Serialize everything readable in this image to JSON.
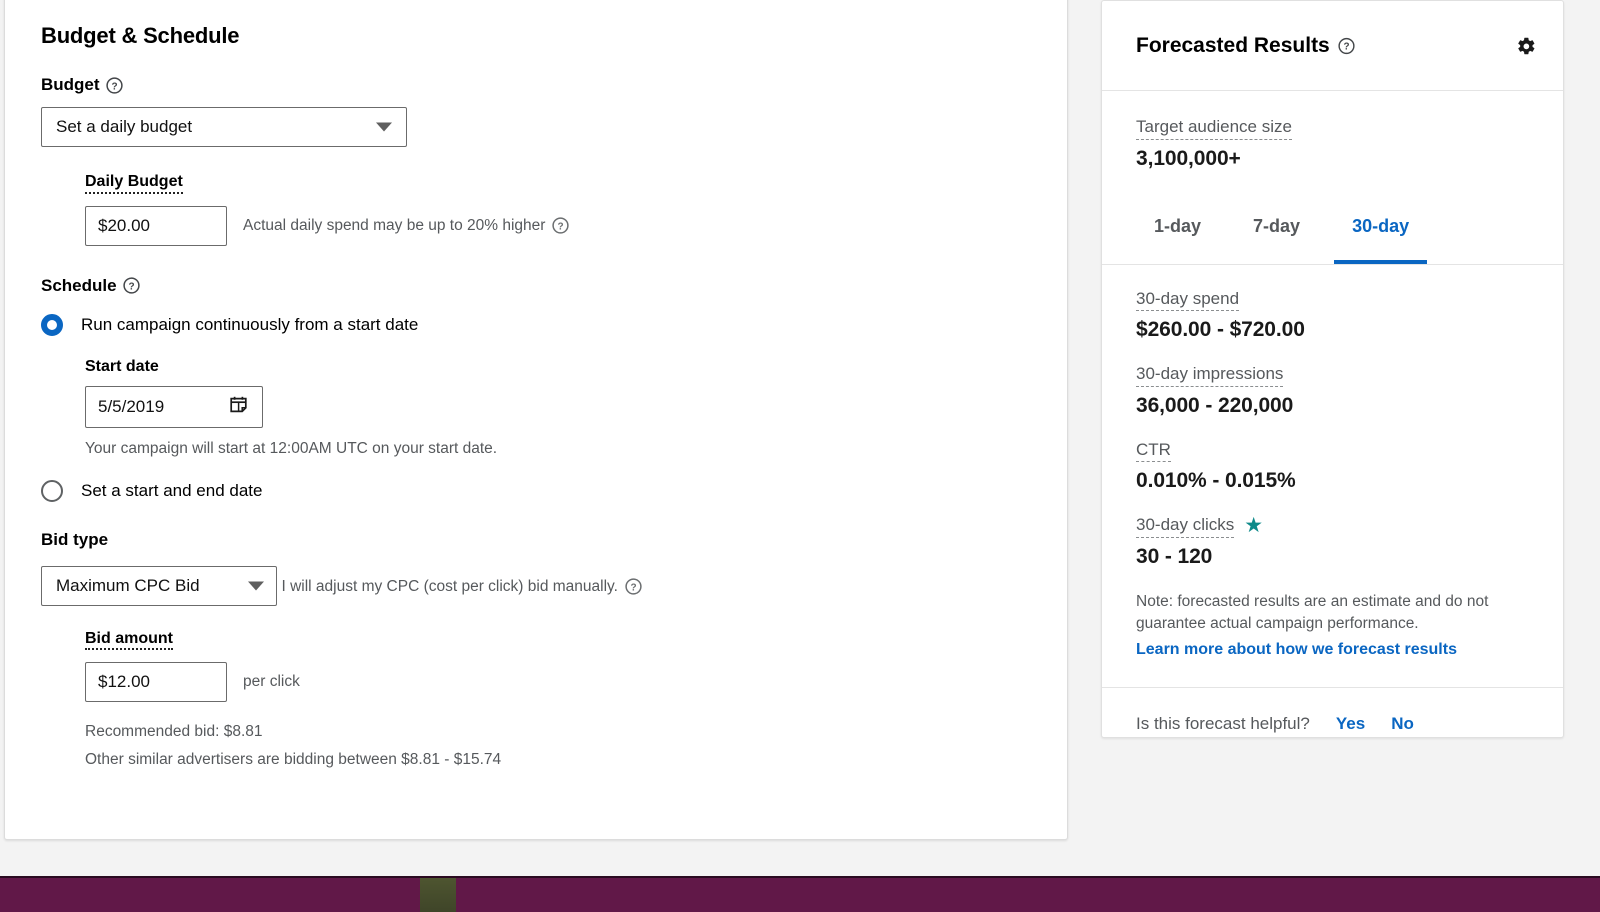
{
  "budget_section": {
    "title": "Budget & Schedule",
    "budget_label": "Budget",
    "budget_help_icon": "help-circle-icon",
    "budget_type_value": "Set a daily budget",
    "budget_type_caret_icon": "chevron-down-icon",
    "daily_budget_label": "Daily Budget",
    "daily_budget_value": "$20.00",
    "daily_budget_hint": "Actual daily spend may be up to 20% higher",
    "daily_budget_hint_icon": "help-circle-icon"
  },
  "schedule_section": {
    "label": "Schedule",
    "help_icon": "help-circle-icon",
    "option_continuous": "Run campaign continuously from a start date",
    "option_start_end": "Set a start and end date",
    "start_date_label": "Start date",
    "start_date_value": "5/5/2019",
    "calendar_icon": "calendar-icon",
    "start_date_note": "Your campaign will start at 12:00AM UTC on your start date."
  },
  "bid_section": {
    "label": "Bid type",
    "bid_type_value": "Maximum CPC Bid",
    "bid_type_caret_icon": "chevron-down-icon",
    "bid_type_note": "I will adjust my CPC (cost per click) bid manually.",
    "bid_type_note_icon": "help-circle-icon",
    "bid_amount_label": "Bid amount",
    "bid_amount_value": "$12.00",
    "per_click": "per click",
    "recommended_bid": "Recommended bid: $8.81",
    "similar_advertisers": "Other similar advertisers are bidding between $8.81 - $15.74"
  },
  "forecast": {
    "title": "Forecasted Results",
    "title_help_icon": "help-circle-icon",
    "settings_icon": "gear-icon",
    "audience": {
      "label": "Target audience size",
      "value": "3,100,000+"
    },
    "tabs": [
      {
        "label": "1-day",
        "active": false
      },
      {
        "label": "7-day",
        "active": false
      },
      {
        "label": "30-day",
        "active": true
      }
    ],
    "metrics": [
      {
        "label": "30-day spend",
        "value": "$260.00 - $720.00",
        "star": false
      },
      {
        "label": "30-day impressions",
        "value": "36,000 - 220,000",
        "star": false
      },
      {
        "label": "CTR",
        "value": "0.010% - 0.015%",
        "star": false
      },
      {
        "label": "30-day clicks",
        "value": "30 - 120",
        "star": true
      }
    ],
    "star_icon": "star-icon",
    "note": "Note: forecasted results are an estimate and do not guarantee actual campaign performance.",
    "learn_more": "Learn more about how we forecast results",
    "feedback_question": "Is this forecast helpful?",
    "feedback_yes": "Yes",
    "feedback_no": "No"
  },
  "colors": {
    "accent_blue": "#0a66c2",
    "star_teal": "#0e8a8a",
    "muted_text": "#56595c",
    "taskbar_purple": "#611848"
  }
}
